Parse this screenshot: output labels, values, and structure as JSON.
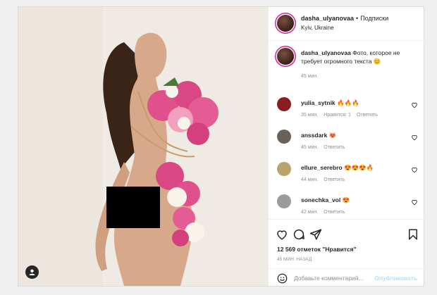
{
  "header": {
    "username": "dasha_ulyanovaa",
    "separator": "•",
    "follow_label": "Подписки",
    "location": "Kyiv, Ukraine"
  },
  "caption": {
    "username": "dasha_ulyanovaa",
    "text": "Фото, которое не требует огромного текста 😊",
    "time": "45 мин."
  },
  "comments": [
    {
      "username": "yulia_sytnik",
      "text": "🔥🔥🔥",
      "time": "35 мин.",
      "likes": "Нравится: 1",
      "reply": "Ответить",
      "avatar_color": "#8a1d1d"
    },
    {
      "username": "anssdark",
      "text": "😻",
      "time": "45 мин.",
      "likes": "",
      "reply": "Ответить",
      "avatar_color": "#6b6257"
    },
    {
      "username": "ellure_serebro",
      "text": "😍😍😍🔥",
      "time": "44 мин.",
      "likes": "",
      "reply": "Ответить",
      "avatar_color": "#b8a46a"
    },
    {
      "username": "sonechka_vol",
      "text": "😍",
      "time": "42 мин.",
      "likes": "",
      "reply": "Ответить",
      "avatar_color": "#9b9b9b"
    }
  ],
  "actions": {
    "likes": "12 569 отметок \"Нравится\"",
    "post_time": "45 МИН. НАЗАД"
  },
  "add_comment": {
    "placeholder": "Добавьте комментарий...",
    "publish_label": "Опубликовать"
  },
  "icons": {
    "like": "heart-icon",
    "comment": "comment-icon",
    "share": "share-icon",
    "save": "bookmark-icon",
    "emoji": "smile-icon",
    "user_tag": "user-tag-icon"
  },
  "colors": {
    "accent_link": "#b2dffc",
    "muted_text": "#8e8e8e",
    "flower_pink": "#e0508a",
    "backdrop": "#efeae4"
  }
}
